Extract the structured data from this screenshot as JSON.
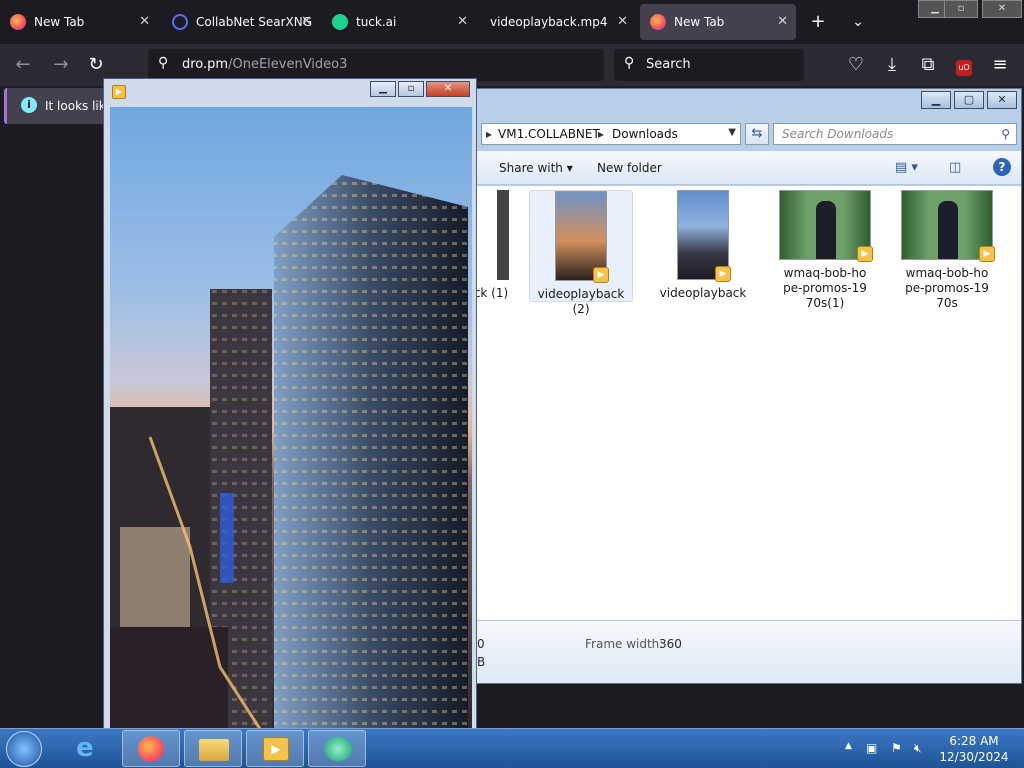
{
  "browser": {
    "tabs": [
      {
        "label": "New Tab",
        "icon": "firefox-icon",
        "active": false
      },
      {
        "label": "CollabNet SearXNG",
        "icon": "searxng-icon",
        "active": false
      },
      {
        "label": "tuck.ai",
        "icon": "tuck-icon",
        "active": false
      },
      {
        "label": "videoplayback.mp4",
        "icon": "",
        "active": false
      },
      {
        "label": "New Tab",
        "icon": "firefox-icon",
        "active": true
      }
    ],
    "url": {
      "host": "dro.pm",
      "path": "/OneElevenVideo3"
    },
    "search_label": "Search",
    "infobar_text": "It looks like"
  },
  "explorer": {
    "breadcrumb": [
      "VM1.COLLABNET",
      "Downloads"
    ],
    "search_placeholder": "Search Downloads",
    "toolbar": {
      "share_label": "Share with",
      "newfolder_label": "New folder"
    },
    "files": [
      {
        "name": "ck (1)"
      },
      {
        "name": "videoplayback (2)"
      },
      {
        "name": "videoplayback"
      },
      {
        "name": "wmaq-bob-hope-promos-1970s(1)"
      },
      {
        "name": "wmaq-bob-hope-promos-1970s"
      }
    ],
    "details": {
      "left_line1": "0",
      "left_line2": "B",
      "frame_width_label": "Frame width:",
      "frame_width_value": "360"
    }
  },
  "taskbar": {
    "time": "6:28 AM",
    "date": "12/30/2024"
  }
}
